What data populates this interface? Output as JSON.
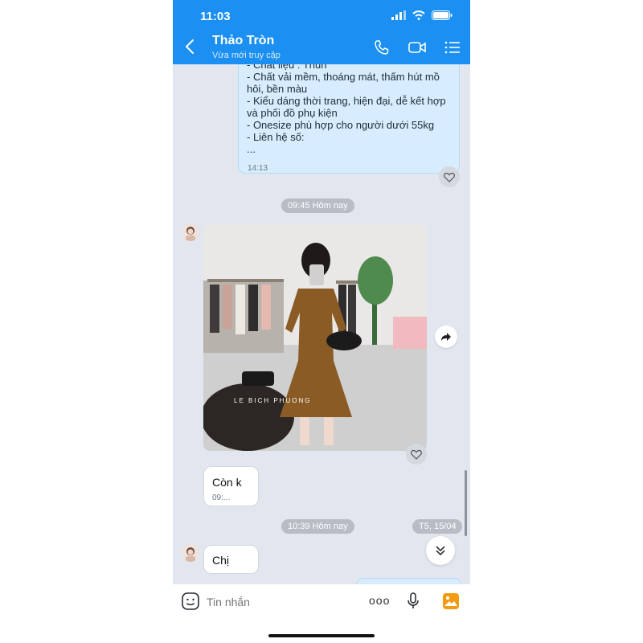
{
  "status_bar": {
    "time": "11:03"
  },
  "header": {
    "title": "Thảo Tròn",
    "subtitle": "Vừa mới truy cập"
  },
  "outgoing_message": {
    "lines": [
      "- Chất liệu : Thun",
      "- Chất vải mềm, thoáng mát, thấm hút mồ",
      "hôi, bền màu",
      "- Kiểu dáng thời trang, hiện đại, dễ kết hợp",
      "và phối đồ phụ kiện",
      "- Onesize phù hợp cho người dưới 55kg",
      "- Liên hệ số:",
      "..."
    ],
    "time": "14:13"
  },
  "separators": {
    "first": "09:45 Hôm nay",
    "second": "10:39 Hôm nay"
  },
  "photo": {
    "watermark": "LE BICH PHUONG"
  },
  "messages": [
    {
      "text": "Còn k",
      "time": "09:..."
    },
    {
      "text": "Chị"
    }
  ],
  "date_tag": "T5, 15/04",
  "input": {
    "placeholder": "Tin nhắn",
    "more_label": "ooo"
  },
  "colors": {
    "header": "#1b8ff2",
    "outgoing_bubble": "#d7ecfd",
    "chat_bg": "#e2e6ee"
  }
}
